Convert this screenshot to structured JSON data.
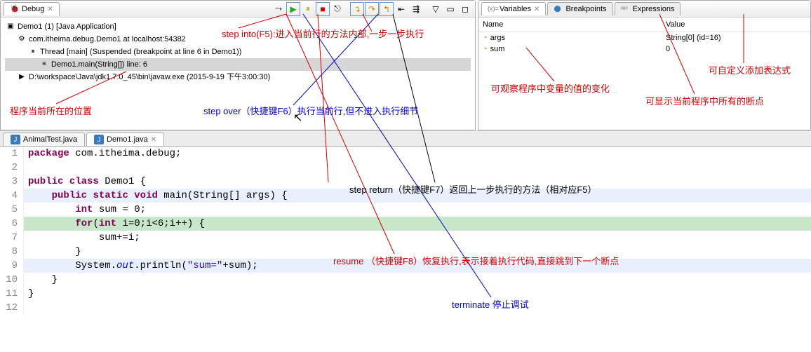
{
  "debug": {
    "tab_label": "Debug",
    "tree": {
      "root": "Demo1 (1) [Java Application]",
      "vm": "com.itheima.debug.Demo1 at localhost:54382",
      "thread": "Thread [main] (Suspended (breakpoint at line 6 in Demo1))",
      "frame": "Demo1.main(String[]) line: 6",
      "process": "D:\\workspace\\Java\\jdk1.7.0_45\\bin\\javaw.exe (2015-9-19 下午3:00:30)"
    }
  },
  "vars": {
    "tab_variables": "Variables",
    "tab_breakpoints": "Breakpoints",
    "tab_expressions": "Expressions",
    "col_name": "Name",
    "col_value": "Value",
    "rows": [
      {
        "name": "args",
        "value": "String[0]  (id=16)"
      },
      {
        "name": "sum",
        "value": "0"
      }
    ]
  },
  "editor": {
    "tabs": {
      "animal": "AnimalTest.java",
      "demo": "Demo1.java"
    },
    "lines": [
      "package com.itheima.debug;",
      "",
      "public class Demo1 {",
      "    public static void main(String[] args) {",
      "        int sum = 0;",
      "        for(int i=0;i<6;i++) {",
      "            sum+=i;",
      "        }",
      "        System.out.println(\"sum=\"+sum);",
      "    }",
      "}",
      ""
    ]
  },
  "annotations": {
    "step_into": "step into(F5):进入当前行的方法内部,一步一步执行",
    "step_over": "step over（快捷键F6）执行当前行,但不进入执行细节",
    "step_return": "step return（快捷键F7）返回上一步执行的方法（相对应F5）",
    "resume": "resume （快捷键F8）恢复执行,表示接着执行代码,直接跳到下一个断点",
    "terminate": "terminate 停止调试",
    "cur_pos": "程序当前所在的位置",
    "watch_vars": "可观察程序中变量的值的变化",
    "show_bp": "可显示当前程序中所有的断点",
    "add_expr": "可自定义添加表达式"
  }
}
